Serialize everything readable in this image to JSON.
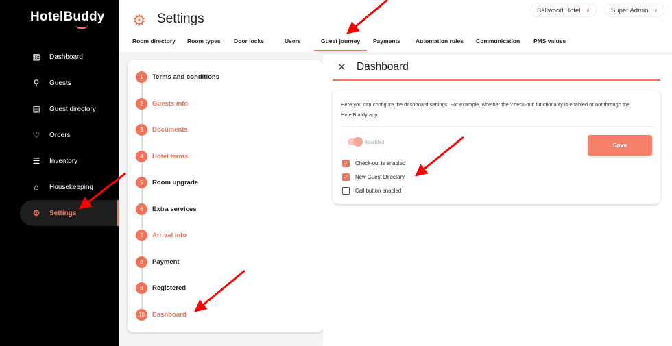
{
  "app": {
    "logo": "HotelBuddy"
  },
  "sidebar": {
    "items": [
      {
        "label": "Dashboard",
        "icon": "dashboard-grid-icon"
      },
      {
        "label": "Guests",
        "icon": "person-icon"
      },
      {
        "label": "Guest directory",
        "icon": "document-icon"
      },
      {
        "label": "Orders",
        "icon": "heart-icon"
      },
      {
        "label": "Inventory",
        "icon": "list-icon"
      },
      {
        "label": "Housekeeping",
        "icon": "home-icon"
      },
      {
        "label": "Settings",
        "icon": "gear-icon",
        "active": true
      }
    ]
  },
  "header": {
    "title": "Settings",
    "hotel_select": "Bellwood Hotel",
    "user_select": "Super Admin"
  },
  "tabs": [
    "Room directory",
    "Room types",
    "Door locks",
    "Users",
    "Guest journey",
    "Payments",
    "Automation rules",
    "Communication",
    "PMS values"
  ],
  "active_tab": "Guest journey",
  "steps": [
    {
      "n": "1",
      "label": "Terms and conditions"
    },
    {
      "n": "2",
      "label": "Guests info"
    },
    {
      "n": "3",
      "label": "Documents"
    },
    {
      "n": "4",
      "label": "Hotel terms"
    },
    {
      "n": "5",
      "label": "Room upgrade"
    },
    {
      "n": "6",
      "label": "Extra services"
    },
    {
      "n": "7",
      "label": "Arrival info"
    },
    {
      "n": "8",
      "label": "Payment"
    },
    {
      "n": "9",
      "label": "Registered"
    },
    {
      "n": "10",
      "label": "Dashboard"
    }
  ],
  "panel": {
    "title": "Dashboard",
    "description": "Here you can configure the dashboard settings. For example, whether the 'check-out' functionality is enabled or not through the HotelBuddy app.",
    "toggle_label": "Enabled",
    "toggle_on": true,
    "save_label": "Save",
    "checkboxes": [
      {
        "label": "Check-out is enabled",
        "checked": true
      },
      {
        "label": "New Guest Directory",
        "checked": true
      },
      {
        "label": "Call button enabled",
        "checked": false
      }
    ]
  },
  "colors": {
    "accent": "#f2725a",
    "sidebar": "#000000"
  }
}
